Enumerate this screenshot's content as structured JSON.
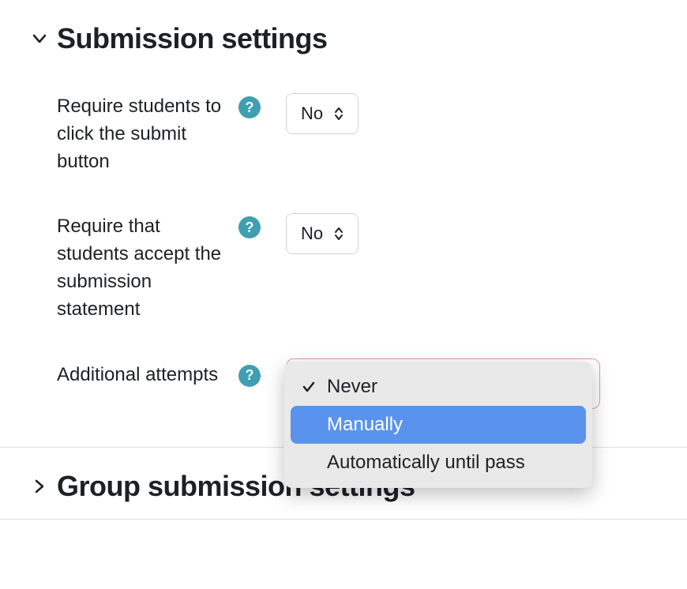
{
  "sections": {
    "submission": {
      "title": "Submission settings",
      "expanded": true,
      "fields": {
        "require_click": {
          "label": "Require students to click the submit button",
          "value": "No"
        },
        "require_statement": {
          "label": "Require that students accept the submission statement",
          "value": "No"
        },
        "additional_attempts": {
          "label": "Additional attempts",
          "selected": "Never",
          "highlighted": "Manually",
          "options": [
            "Never",
            "Manually",
            "Automatically until pass"
          ]
        }
      }
    },
    "group_submission": {
      "title": "Group submission settings",
      "expanded": false
    }
  }
}
